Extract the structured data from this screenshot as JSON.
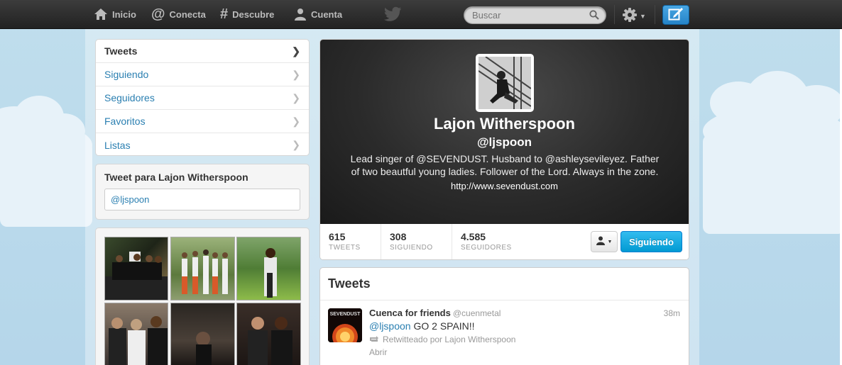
{
  "topbar": {
    "nav": [
      {
        "label": "Inicio",
        "icon": "home-icon"
      },
      {
        "label": "Conecta",
        "icon": "at-icon"
      },
      {
        "label": "Descubre",
        "icon": "hash-icon"
      },
      {
        "label": "Cuenta",
        "icon": "person-icon"
      }
    ],
    "search_placeholder": "Buscar"
  },
  "leftnav": {
    "items": [
      {
        "label": "Tweets",
        "active": true
      },
      {
        "label": "Siguiendo"
      },
      {
        "label": "Seguidores"
      },
      {
        "label": "Favoritos"
      },
      {
        "label": "Listas"
      }
    ]
  },
  "tweet_to": {
    "title": "Tweet para Lajon Witherspoon",
    "prefill": "@ljspoon"
  },
  "profile": {
    "name": "Lajon Witherspoon",
    "handle": "@ljspoon",
    "bio": "Lead singer of @SEVENDUST. Husband to @ashleysevileyez. Father of two beautful young ladies. Follower of the Lord. Always in the zone.",
    "url": "http://www.sevendust.com",
    "stats": [
      {
        "num": "615",
        "label": "TWEETS"
      },
      {
        "num": "308",
        "label": "SIGUIENDO"
      },
      {
        "num": "4.585",
        "label": "SEGUIDORES"
      }
    ],
    "follow_label": "Siguiendo"
  },
  "tweets": {
    "header": "Tweets",
    "items": [
      {
        "name": "Cuenca for friends",
        "screen_name": "@cuenmetal",
        "time": "38m",
        "mention": "@ljspoon",
        "text": " GO 2 SPAIN!!",
        "retweeted_by": "Retwitteado por Lajon Witherspoon",
        "open": "Abrir"
      }
    ]
  },
  "colors": {
    "link": "#2a7fb1",
    "accent": "#019ad2",
    "topbar": "#2b2b2b"
  }
}
